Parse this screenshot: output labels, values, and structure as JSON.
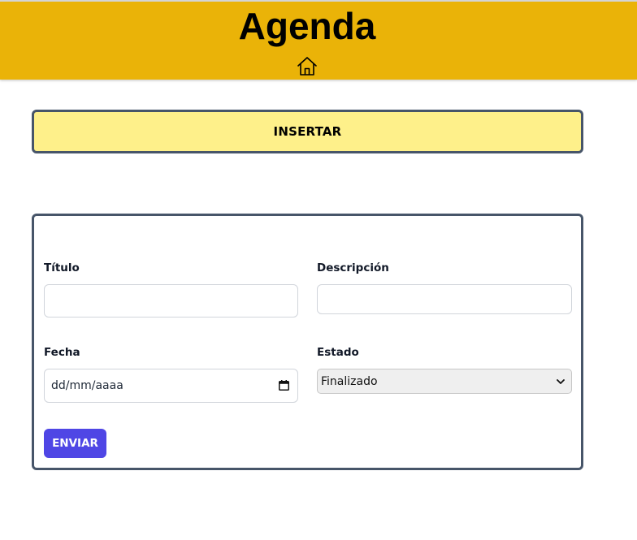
{
  "header": {
    "title": "Agenda",
    "home_icon": "home-icon",
    "background": "#eab308"
  },
  "insert_button": {
    "label": "INSERTAR",
    "background": "#fef08a"
  },
  "form": {
    "titulo": {
      "label": "Título",
      "value": ""
    },
    "descripcion": {
      "label": "Descripción",
      "value": ""
    },
    "fecha": {
      "label": "Fecha",
      "placeholder": "dd/mm/aaaa",
      "icon": "calendar-icon"
    },
    "estado": {
      "label": "Estado",
      "selected": "Finalizado",
      "icon": "chevron-down-icon"
    },
    "submit_label": "ENVIAR",
    "submit_color": "#4f46e5"
  }
}
